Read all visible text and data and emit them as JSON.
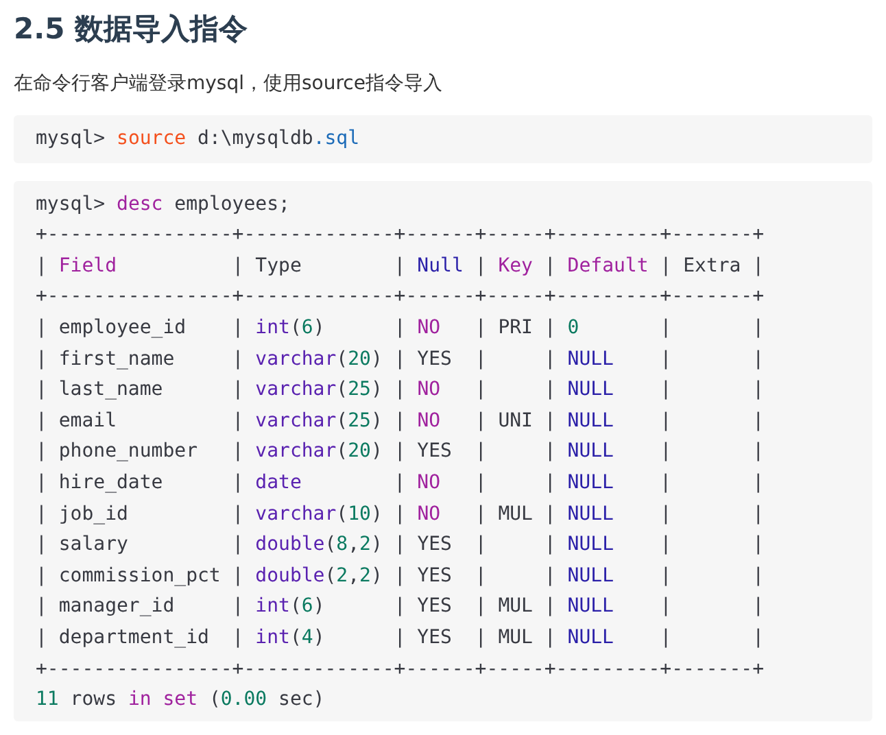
{
  "heading": "2.5 数据导入指令",
  "intro": "在命令行客户端登录mysql，使用source指令导入",
  "code_blocks": [
    {
      "lines": [
        [
          {
            "text": "mysql> ",
            "kind": "plain"
          },
          {
            "text": "source",
            "kind": "command"
          },
          {
            "text": " d:\\mysqldb",
            "kind": "plain"
          },
          {
            "text": ".sql",
            "kind": "attribute"
          }
        ]
      ]
    },
    {
      "lines": [
        [
          {
            "text": "mysql> ",
            "kind": "plain"
          },
          {
            "text": "desc",
            "kind": "keyword"
          },
          {
            "text": " employees;",
            "kind": "plain"
          }
        ],
        [
          {
            "text": "+----------------+-------------+------+-----+---------+-------+",
            "kind": "plain"
          }
        ],
        [
          {
            "text": "| ",
            "kind": "plain"
          },
          {
            "text": "Field",
            "kind": "keyword"
          },
          {
            "text": "          | Type        | ",
            "kind": "plain"
          },
          {
            "text": "Null",
            "kind": "constant"
          },
          {
            "text": " | ",
            "kind": "plain"
          },
          {
            "text": "Key",
            "kind": "keyword"
          },
          {
            "text": " | ",
            "kind": "plain"
          },
          {
            "text": "Default",
            "kind": "keyword"
          },
          {
            "text": " | Extra |",
            "kind": "plain"
          }
        ],
        [
          {
            "text": "+----------------+-------------+------+-----+---------+-------+",
            "kind": "plain"
          }
        ],
        [
          {
            "text": "| employee_id    | ",
            "kind": "plain"
          },
          {
            "text": "int",
            "kind": "type"
          },
          {
            "text": "(",
            "kind": "plain"
          },
          {
            "text": "6",
            "kind": "number"
          },
          {
            "text": ")      | ",
            "kind": "plain"
          },
          {
            "text": "NO",
            "kind": "keyword"
          },
          {
            "text": "   | PRI | ",
            "kind": "plain"
          },
          {
            "text": "0",
            "kind": "number"
          },
          {
            "text": "       |       |",
            "kind": "plain"
          }
        ],
        [
          {
            "text": "| first_name     | ",
            "kind": "plain"
          },
          {
            "text": "varchar",
            "kind": "type"
          },
          {
            "text": "(",
            "kind": "plain"
          },
          {
            "text": "20",
            "kind": "number"
          },
          {
            "text": ") | YES  |     | ",
            "kind": "plain"
          },
          {
            "text": "NULL",
            "kind": "constant"
          },
          {
            "text": "    |       |",
            "kind": "plain"
          }
        ],
        [
          {
            "text": "| last_name      | ",
            "kind": "plain"
          },
          {
            "text": "varchar",
            "kind": "type"
          },
          {
            "text": "(",
            "kind": "plain"
          },
          {
            "text": "25",
            "kind": "number"
          },
          {
            "text": ") | ",
            "kind": "plain"
          },
          {
            "text": "NO",
            "kind": "keyword"
          },
          {
            "text": "   |     | ",
            "kind": "plain"
          },
          {
            "text": "NULL",
            "kind": "constant"
          },
          {
            "text": "    |       |",
            "kind": "plain"
          }
        ],
        [
          {
            "text": "| email          | ",
            "kind": "plain"
          },
          {
            "text": "varchar",
            "kind": "type"
          },
          {
            "text": "(",
            "kind": "plain"
          },
          {
            "text": "25",
            "kind": "number"
          },
          {
            "text": ") | ",
            "kind": "plain"
          },
          {
            "text": "NO",
            "kind": "keyword"
          },
          {
            "text": "   | UNI | ",
            "kind": "plain"
          },
          {
            "text": "NULL",
            "kind": "constant"
          },
          {
            "text": "    |       |",
            "kind": "plain"
          }
        ],
        [
          {
            "text": "| phone_number   | ",
            "kind": "plain"
          },
          {
            "text": "varchar",
            "kind": "type"
          },
          {
            "text": "(",
            "kind": "plain"
          },
          {
            "text": "20",
            "kind": "number"
          },
          {
            "text": ") | YES  |     | ",
            "kind": "plain"
          },
          {
            "text": "NULL",
            "kind": "constant"
          },
          {
            "text": "    |       |",
            "kind": "plain"
          }
        ],
        [
          {
            "text": "| hire_date      | ",
            "kind": "plain"
          },
          {
            "text": "date",
            "kind": "type"
          },
          {
            "text": "        | ",
            "kind": "plain"
          },
          {
            "text": "NO",
            "kind": "keyword"
          },
          {
            "text": "   |     | ",
            "kind": "plain"
          },
          {
            "text": "NULL",
            "kind": "constant"
          },
          {
            "text": "    |       |",
            "kind": "plain"
          }
        ],
        [
          {
            "text": "| job_id         | ",
            "kind": "plain"
          },
          {
            "text": "varchar",
            "kind": "type"
          },
          {
            "text": "(",
            "kind": "plain"
          },
          {
            "text": "10",
            "kind": "number"
          },
          {
            "text": ") | ",
            "kind": "plain"
          },
          {
            "text": "NO",
            "kind": "keyword"
          },
          {
            "text": "   | MUL | ",
            "kind": "plain"
          },
          {
            "text": "NULL",
            "kind": "constant"
          },
          {
            "text": "    |       |",
            "kind": "plain"
          }
        ],
        [
          {
            "text": "| salary         | ",
            "kind": "plain"
          },
          {
            "text": "double",
            "kind": "type"
          },
          {
            "text": "(",
            "kind": "plain"
          },
          {
            "text": "8",
            "kind": "number"
          },
          {
            "text": ",",
            "kind": "plain"
          },
          {
            "text": "2",
            "kind": "number"
          },
          {
            "text": ") | YES  |     | ",
            "kind": "plain"
          },
          {
            "text": "NULL",
            "kind": "constant"
          },
          {
            "text": "    |       |",
            "kind": "plain"
          }
        ],
        [
          {
            "text": "| commission_pct | ",
            "kind": "plain"
          },
          {
            "text": "double",
            "kind": "type"
          },
          {
            "text": "(",
            "kind": "plain"
          },
          {
            "text": "2",
            "kind": "number"
          },
          {
            "text": ",",
            "kind": "plain"
          },
          {
            "text": "2",
            "kind": "number"
          },
          {
            "text": ") | YES  |     | ",
            "kind": "plain"
          },
          {
            "text": "NULL",
            "kind": "constant"
          },
          {
            "text": "    |       |",
            "kind": "plain"
          }
        ],
        [
          {
            "text": "| manager_id     | ",
            "kind": "plain"
          },
          {
            "text": "int",
            "kind": "type"
          },
          {
            "text": "(",
            "kind": "plain"
          },
          {
            "text": "6",
            "kind": "number"
          },
          {
            "text": ")      | YES  | MUL | ",
            "kind": "plain"
          },
          {
            "text": "NULL",
            "kind": "constant"
          },
          {
            "text": "    |       |",
            "kind": "plain"
          }
        ],
        [
          {
            "text": "| department_id  | ",
            "kind": "plain"
          },
          {
            "text": "int",
            "kind": "type"
          },
          {
            "text": "(",
            "kind": "plain"
          },
          {
            "text": "4",
            "kind": "number"
          },
          {
            "text": ")      | YES  | MUL | ",
            "kind": "plain"
          },
          {
            "text": "NULL",
            "kind": "constant"
          },
          {
            "text": "    |       |",
            "kind": "plain"
          }
        ],
        [
          {
            "text": "+----------------+-------------+------+-----+---------+-------+",
            "kind": "plain"
          }
        ],
        [
          {
            "text": "11",
            "kind": "number"
          },
          {
            "text": " rows ",
            "kind": "plain"
          },
          {
            "text": "in set",
            "kind": "keyword"
          },
          {
            "text": " (",
            "kind": "plain"
          },
          {
            "text": "0.00",
            "kind": "number"
          },
          {
            "text": " sec)",
            "kind": "plain"
          }
        ]
      ]
    }
  ]
}
